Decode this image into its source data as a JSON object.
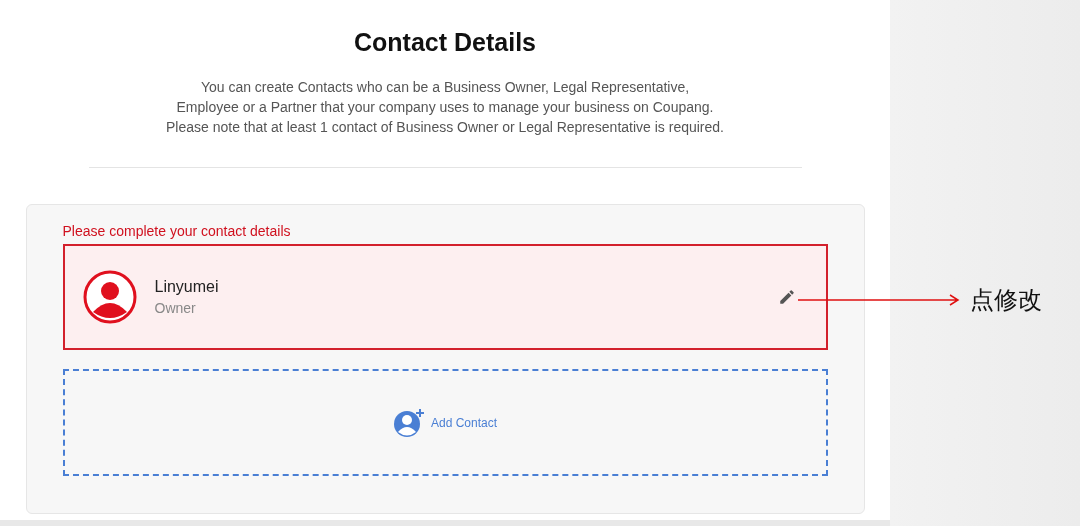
{
  "header": {
    "title": "Contact Details",
    "description": [
      "You can create Contacts who can be a Business Owner, Legal Representative,",
      "Employee or a Partner that your company uses to manage your business on Coupang.",
      "Please note that at least 1 contact of Business Owner or Legal Representative is required."
    ]
  },
  "contacts_panel": {
    "error": "Please complete your contact details",
    "contacts": [
      {
        "name": "Linyumei",
        "role": "Owner",
        "incomplete": true
      }
    ],
    "add_button": "Add Contact"
  },
  "annotation": {
    "text": "点修改"
  }
}
